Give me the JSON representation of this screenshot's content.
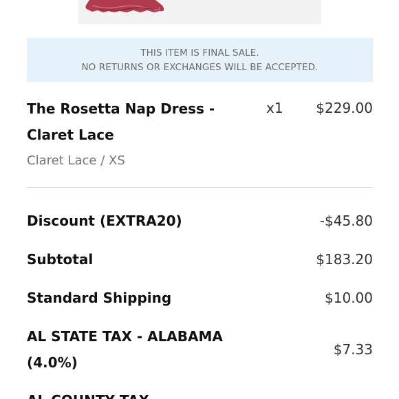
{
  "notice": {
    "line1": "THIS ITEM IS FINAL SALE.",
    "line2": "NO RETURNS OR EXCHANGES WILL BE ACCEPTED."
  },
  "item": {
    "name_line1": "The Rosetta Nap Dress -",
    "name_line2": "Claret Lace",
    "quantity": "x1",
    "price": "$229.00",
    "variant": "Claret Lace / XS"
  },
  "summary": {
    "discount_label": "Discount (EXTRA20)",
    "discount_value": "-$45.80",
    "subtotal_label": "Subtotal",
    "subtotal_value": "$183.20",
    "shipping_label": "Standard Shipping",
    "shipping_value": "$10.00",
    "state_tax_label_line1": "AL STATE TAX - ALABAMA",
    "state_tax_label_line2": "(4.0%)",
    "state_tax_value": "$7.33",
    "county_tax_label": "AL COUNTY TAX"
  },
  "colors": {
    "notice_bg": "#e6f2fb",
    "dress": "#b03a4e"
  }
}
